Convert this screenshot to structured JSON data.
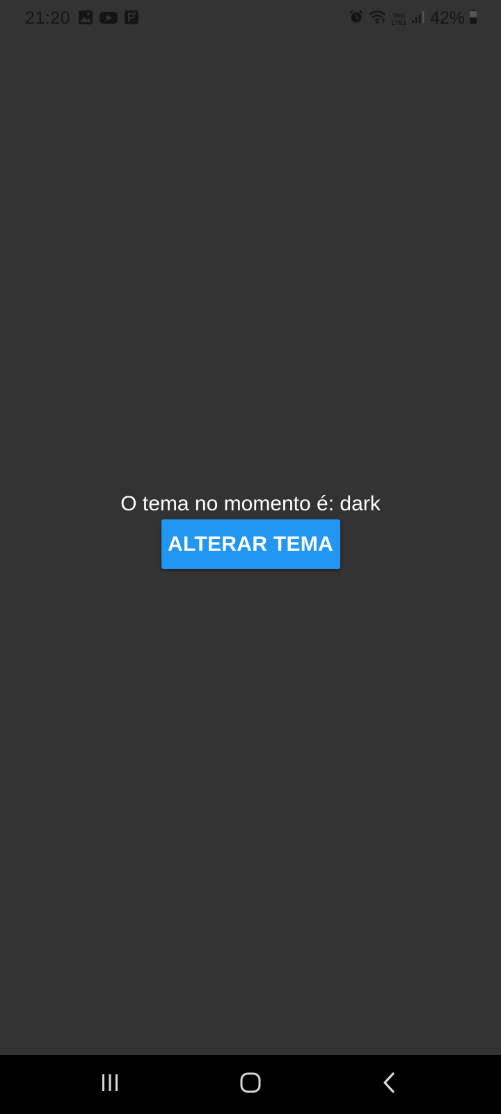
{
  "status_bar": {
    "time": "21:20",
    "battery": "42%",
    "network_label_top": "Vo))",
    "network_label_bottom": "LTE1",
    "notification_icons": [
      "gallery-icon",
      "youtube-icon",
      "parking-app-icon"
    ],
    "system_icons": [
      "alarm-icon",
      "wifi-icon",
      "volte-icon",
      "signal-icon",
      "battery-icon"
    ]
  },
  "main": {
    "theme_text": "O tema no momento é: dark",
    "button_label": "ALTERAR TEMA"
  },
  "nav_bar": {
    "buttons": [
      "recent-apps-icon",
      "home-icon",
      "back-icon"
    ]
  },
  "colors": {
    "background": "#333333",
    "accent": "#2196F3",
    "text": "#ffffff",
    "nav_bar": "#000000"
  }
}
